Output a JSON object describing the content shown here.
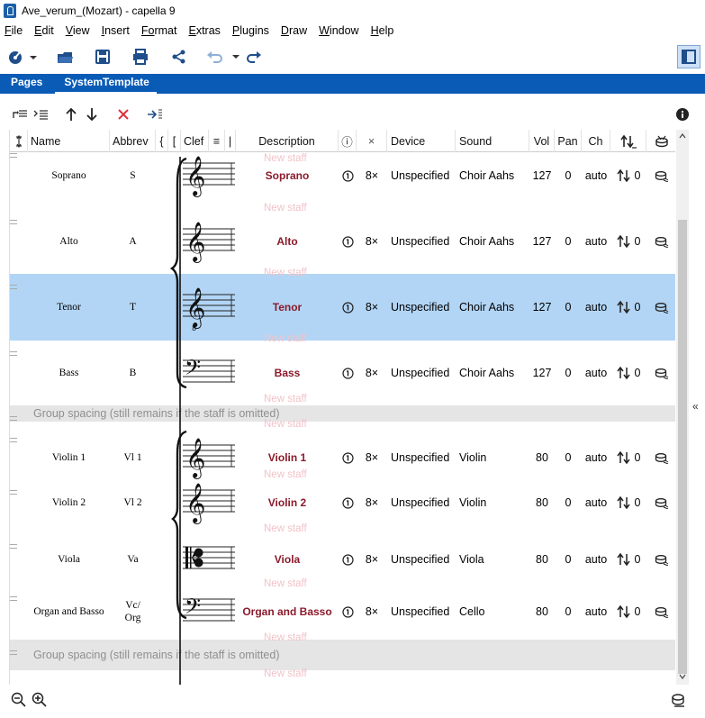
{
  "window": {
    "title": "Ave_verum_(Mozart)  - capella 9"
  },
  "menu": [
    {
      "id": "file",
      "label": "File",
      "u": "F",
      "rest": "ile"
    },
    {
      "id": "edit",
      "label": "Edit",
      "u": "E",
      "rest": "dit"
    },
    {
      "id": "view",
      "label": "View",
      "u": "V",
      "rest": "iew"
    },
    {
      "id": "insert",
      "label": "Insert",
      "u": "I",
      "rest": "nsert"
    },
    {
      "id": "format",
      "label": "Format",
      "u": "Fo",
      "rest": "rmat"
    },
    {
      "id": "extras",
      "label": "Extras",
      "u": "E",
      "rest": "xtras"
    },
    {
      "id": "plugins",
      "label": "Plugins",
      "u": "P",
      "rest": "lugins"
    },
    {
      "id": "draw",
      "label": "Draw",
      "u": "D",
      "rest": "raw"
    },
    {
      "id": "window",
      "label": "Window",
      "u": "W",
      "rest": "indow"
    },
    {
      "id": "help",
      "label": "Help",
      "u": "H",
      "rest": "elp"
    }
  ],
  "tabs": [
    {
      "label": "Pages",
      "active": false
    },
    {
      "label": "SystemTemplate",
      "active": true
    }
  ],
  "columns": {
    "name": "Name",
    "abbrev": "Abbrev",
    "brace": "{",
    "bracket": "[",
    "clef": "Clef",
    "lines": "≡",
    "bar": "|",
    "description": "Description",
    "instr": "ⓘ",
    "times": "×",
    "device": "Device",
    "sound": "Sound",
    "vol": "Vol",
    "pan": "Pan",
    "ch": "Ch"
  },
  "ghost_label": "New staff",
  "group_spacing_label": "Group spacing (still remains if the staff is omitted)",
  "staves": [
    {
      "name": "Soprano",
      "abbrev": "S",
      "clef": "treble",
      "description": "Soprano",
      "mult": "8×",
      "device": "Unspecified",
      "sound": "Choir Aahs",
      "vol": "127",
      "pan": "0",
      "ch": "auto",
      "transpose": "0"
    },
    {
      "name": "Alto",
      "abbrev": "A",
      "clef": "treble",
      "description": "Alto",
      "mult": "8×",
      "device": "Unspecified",
      "sound": "Choir Aahs",
      "vol": "127",
      "pan": "0",
      "ch": "auto",
      "transpose": "0"
    },
    {
      "name": "Tenor",
      "abbrev": "T",
      "clef": "treble8",
      "description": "Tenor",
      "mult": "8×",
      "device": "Unspecified",
      "sound": "Choir Aahs",
      "vol": "127",
      "pan": "0",
      "ch": "auto",
      "transpose": "0",
      "selected": true
    },
    {
      "name": "Bass",
      "abbrev": "B",
      "clef": "bass",
      "description": "Bass",
      "mult": "8×",
      "device": "Unspecified",
      "sound": "Choir Aahs",
      "vol": "127",
      "pan": "0",
      "ch": "auto",
      "transpose": "0"
    },
    {
      "name": "Violin 1",
      "abbrev": "Vl 1",
      "clef": "treble",
      "description": "Violin 1",
      "mult": "8×",
      "device": "Unspecified",
      "sound": "Violin",
      "vol": "80",
      "pan": "0",
      "ch": "auto",
      "transpose": "0"
    },
    {
      "name": "Violin 2",
      "abbrev": "Vl 2",
      "clef": "treble",
      "description": "Violin 2",
      "mult": "8×",
      "device": "Unspecified",
      "sound": "Violin",
      "vol": "80",
      "pan": "0",
      "ch": "auto",
      "transpose": "0"
    },
    {
      "name": "Viola",
      "abbrev": "Va",
      "clef": "alto",
      "description": "Viola",
      "mult": "8×",
      "device": "Unspecified",
      "sound": "Viola",
      "vol": "80",
      "pan": "0",
      "ch": "auto",
      "transpose": "0"
    },
    {
      "name": "Organ and Basso",
      "abbrev": "Vc/\nOrg",
      "abbrev_line1": "Vc/",
      "abbrev_line2": "Org",
      "clef": "bass",
      "description": "Organ and Basso",
      "mult": "8×",
      "device": "Unspecified",
      "sound": "Cello",
      "vol": "80",
      "pan": "0",
      "ch": "auto",
      "transpose": "0"
    }
  ],
  "colors": {
    "accent": "#0a5bb6",
    "selected_row": "#b2d5f5",
    "description_text": "#8b1a2b",
    "ghost_text": "#f1c3c8",
    "group_row": "#e5e5e5"
  }
}
